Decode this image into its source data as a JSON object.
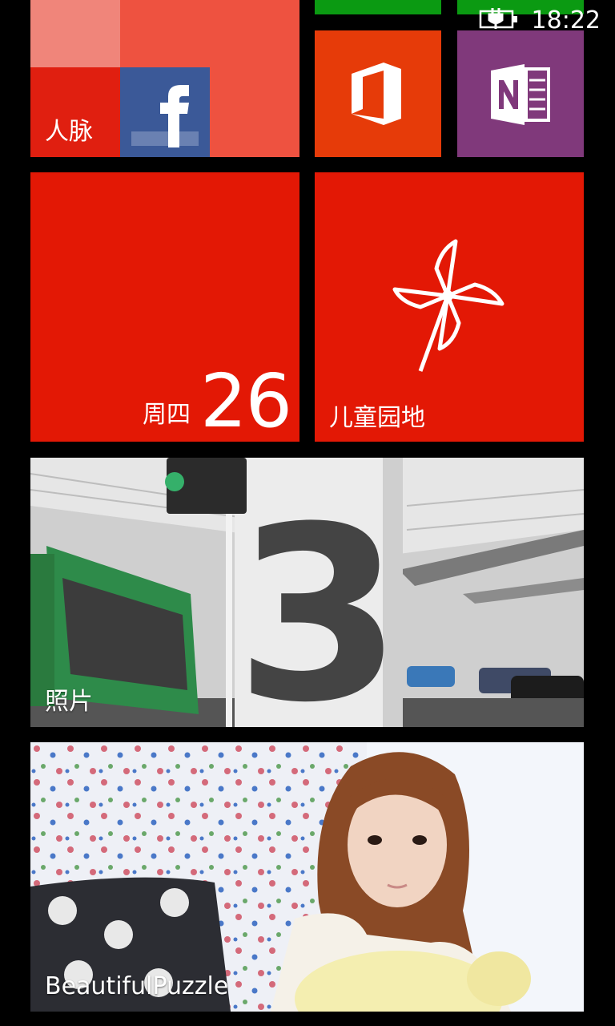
{
  "status": {
    "time": "18:22",
    "battery_icon": "battery-charging-icon"
  },
  "tiles": {
    "people": {
      "label": "人脉",
      "color": "#ee5240",
      "icon": "facebook-icon"
    },
    "office": {
      "color": "#e63b09",
      "icon": "office-icon"
    },
    "onenote": {
      "color": "#80397b",
      "icon": "onenote-icon"
    },
    "calendar": {
      "day": "周四",
      "date": "26",
      "color": "#e31805"
    },
    "kids_corner": {
      "label": "儿童园地",
      "color": "#e31805",
      "icon": "pinwheel-icon"
    },
    "photos": {
      "label": "照片"
    },
    "beautiful_puzzle": {
      "label": "BeautifulPuzzle"
    }
  },
  "colors": {
    "green_partial": "#0b9a12",
    "background": "#000000"
  }
}
